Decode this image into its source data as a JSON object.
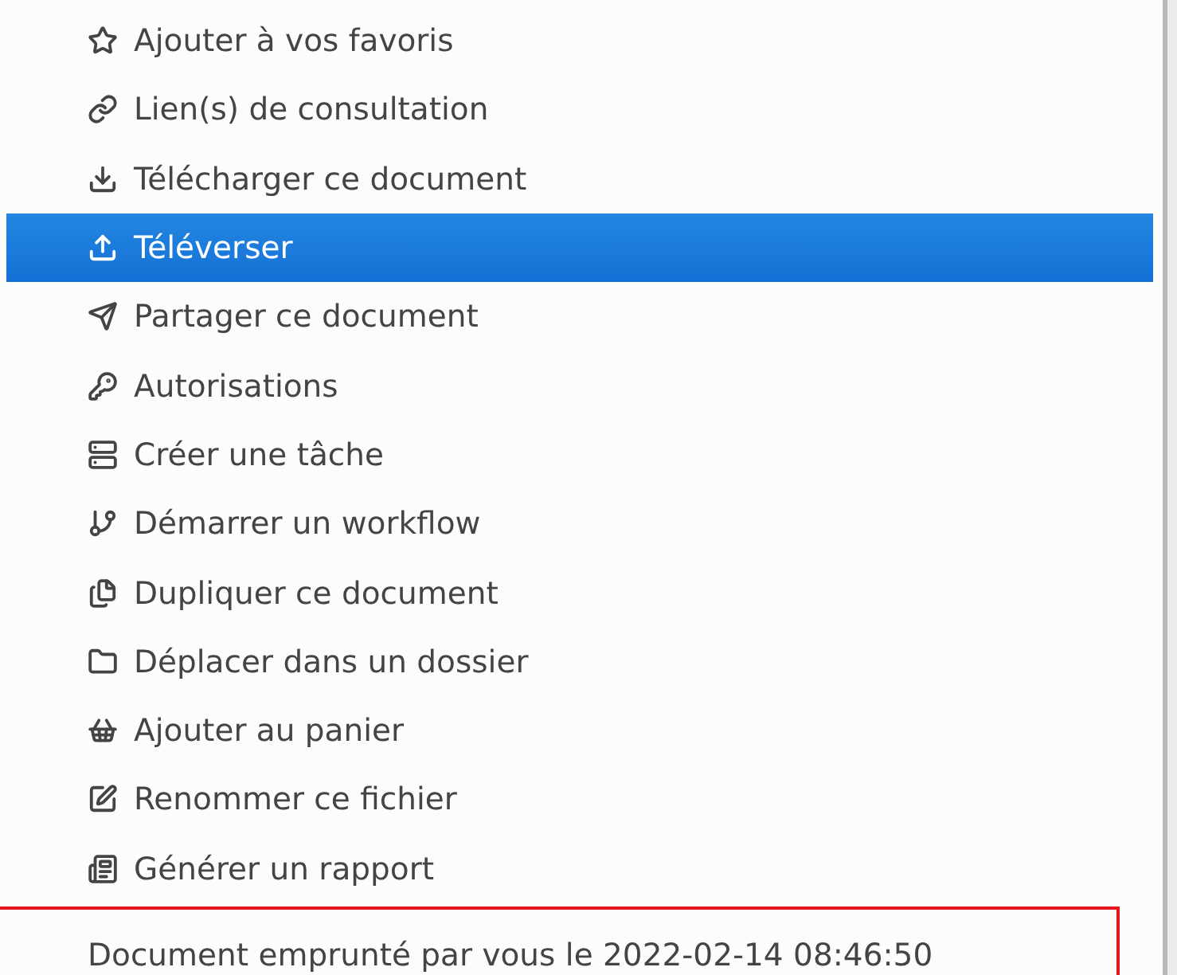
{
  "menu": {
    "items": [
      {
        "label": "Ajouter à vos favoris",
        "selected": false
      },
      {
        "label": "Lien(s) de consultation",
        "selected": false
      },
      {
        "label": "Télécharger ce document",
        "selected": false
      },
      {
        "label": "Téléverser",
        "selected": true
      },
      {
        "label": "Partager ce document",
        "selected": false
      },
      {
        "label": "Autorisations",
        "selected": false
      },
      {
        "label": "Créer une tâche",
        "selected": false
      },
      {
        "label": "Démarrer un workflow",
        "selected": false
      },
      {
        "label": "Dupliquer ce document",
        "selected": false
      },
      {
        "label": "Déplacer dans un dossier",
        "selected": false
      },
      {
        "label": "Ajouter au panier",
        "selected": false
      },
      {
        "label": "Renommer ce fichier",
        "selected": false
      },
      {
        "label": "Générer un rapport",
        "selected": false
      }
    ]
  },
  "status": {
    "text": "Document emprunté par vous le 2022-02-14 08:46:50"
  }
}
